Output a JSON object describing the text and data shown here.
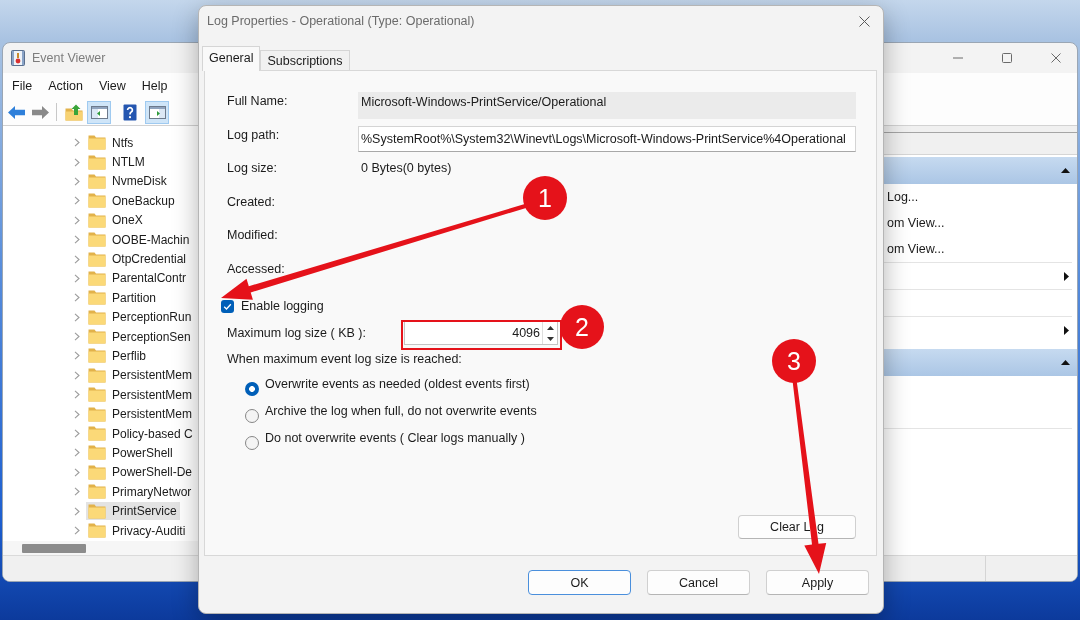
{
  "event_viewer": {
    "title": "Event Viewer",
    "menu": [
      "File",
      "Action",
      "View",
      "Help"
    ],
    "toolbar": [
      {
        "on": false
      },
      {
        "on": false
      },
      {
        "on": false
      },
      {
        "on": true
      },
      {
        "on": false
      },
      {
        "on": true
      }
    ],
    "tree": [
      {
        "label": "Ntfs",
        "selected": false
      },
      {
        "label": "NTLM",
        "selected": false
      },
      {
        "label": "NvmeDisk",
        "selected": false
      },
      {
        "label": "OneBackup",
        "selected": false
      },
      {
        "label": "OneX",
        "selected": false
      },
      {
        "label": "OOBE-Machin",
        "selected": false
      },
      {
        "label": "OtpCredential",
        "selected": false
      },
      {
        "label": "ParentalContr",
        "selected": false
      },
      {
        "label": "Partition",
        "selected": false
      },
      {
        "label": "PerceptionRun",
        "selected": false
      },
      {
        "label": "PerceptionSen",
        "selected": false
      },
      {
        "label": "Perflib",
        "selected": false
      },
      {
        "label": "PersistentMem",
        "selected": false
      },
      {
        "label": "PersistentMem",
        "selected": false
      },
      {
        "label": "PersistentMem",
        "selected": false
      },
      {
        "label": "Policy-based C",
        "selected": false
      },
      {
        "label": "PowerShell",
        "selected": false
      },
      {
        "label": "PowerShell-De",
        "selected": false
      },
      {
        "label": "PrimaryNetwor",
        "selected": false
      },
      {
        "label": "PrintService",
        "selected": true
      },
      {
        "label": "Privacy-Auditi",
        "selected": false
      }
    ],
    "actions": [
      {
        "kind": "header"
      },
      {
        "kind": "item",
        "label": "Log..."
      },
      {
        "kind": "item",
        "label": "om View..."
      },
      {
        "kind": "item",
        "label": "om View..."
      },
      {
        "kind": "separator"
      },
      {
        "kind": "submenu"
      },
      {
        "kind": "separator"
      },
      {
        "kind": "blank"
      },
      {
        "kind": "separator"
      },
      {
        "kind": "submenu"
      },
      {
        "kind": "header"
      },
      {
        "kind": "blank"
      },
      {
        "kind": "blank"
      },
      {
        "kind": "separator"
      }
    ]
  },
  "dialog": {
    "title": "Log Properties - Operational (Type: Operational)",
    "tabs": [
      {
        "label": "General",
        "selected": true
      },
      {
        "label": "Subscriptions",
        "selected": false
      }
    ],
    "fields": [
      {
        "label": "Full Name:",
        "kind": "readonly",
        "value": "Microsoft-Windows-PrintService/Operational"
      },
      {
        "label": "Log path:",
        "kind": "text",
        "value": "%SystemRoot%\\System32\\Winevt\\Logs\\Microsoft-Windows-PrintService%4Operational"
      },
      {
        "label": "Log size:",
        "kind": "plain",
        "value": "0 Bytes(0 bytes)"
      },
      {
        "label": "Created:",
        "kind": "plain"
      },
      {
        "label": "Modified:",
        "kind": "plain"
      },
      {
        "label": "Accessed:",
        "kind": "plain"
      }
    ],
    "enable_logging": {
      "label": "Enable logging",
      "checked": true
    },
    "max_size": {
      "label": "Maximum log size ( KB ):",
      "value": "4096"
    },
    "policy_label": "When maximum event log size is reached:",
    "policy_options": [
      {
        "label": "Overwrite events as needed (oldest events first)",
        "selected": true
      },
      {
        "label": "Archive the log when full, do not overwrite events",
        "selected": false
      },
      {
        "label": "Do not overwrite events ( Clear logs manually )",
        "selected": false
      }
    ],
    "clear_log": [
      "Clear L",
      "g"
    ],
    "buttons": [
      {
        "label": "OK",
        "default": true
      },
      {
        "label": "Cancel",
        "default": false
      },
      {
        "label": "Apply",
        "default": false
      }
    ]
  },
  "annotations": [
    {
      "label": "1",
      "kind": "arrow"
    },
    {
      "label": "2",
      "kind": "frame"
    },
    {
      "label": "3",
      "kind": "arrow"
    }
  ]
}
